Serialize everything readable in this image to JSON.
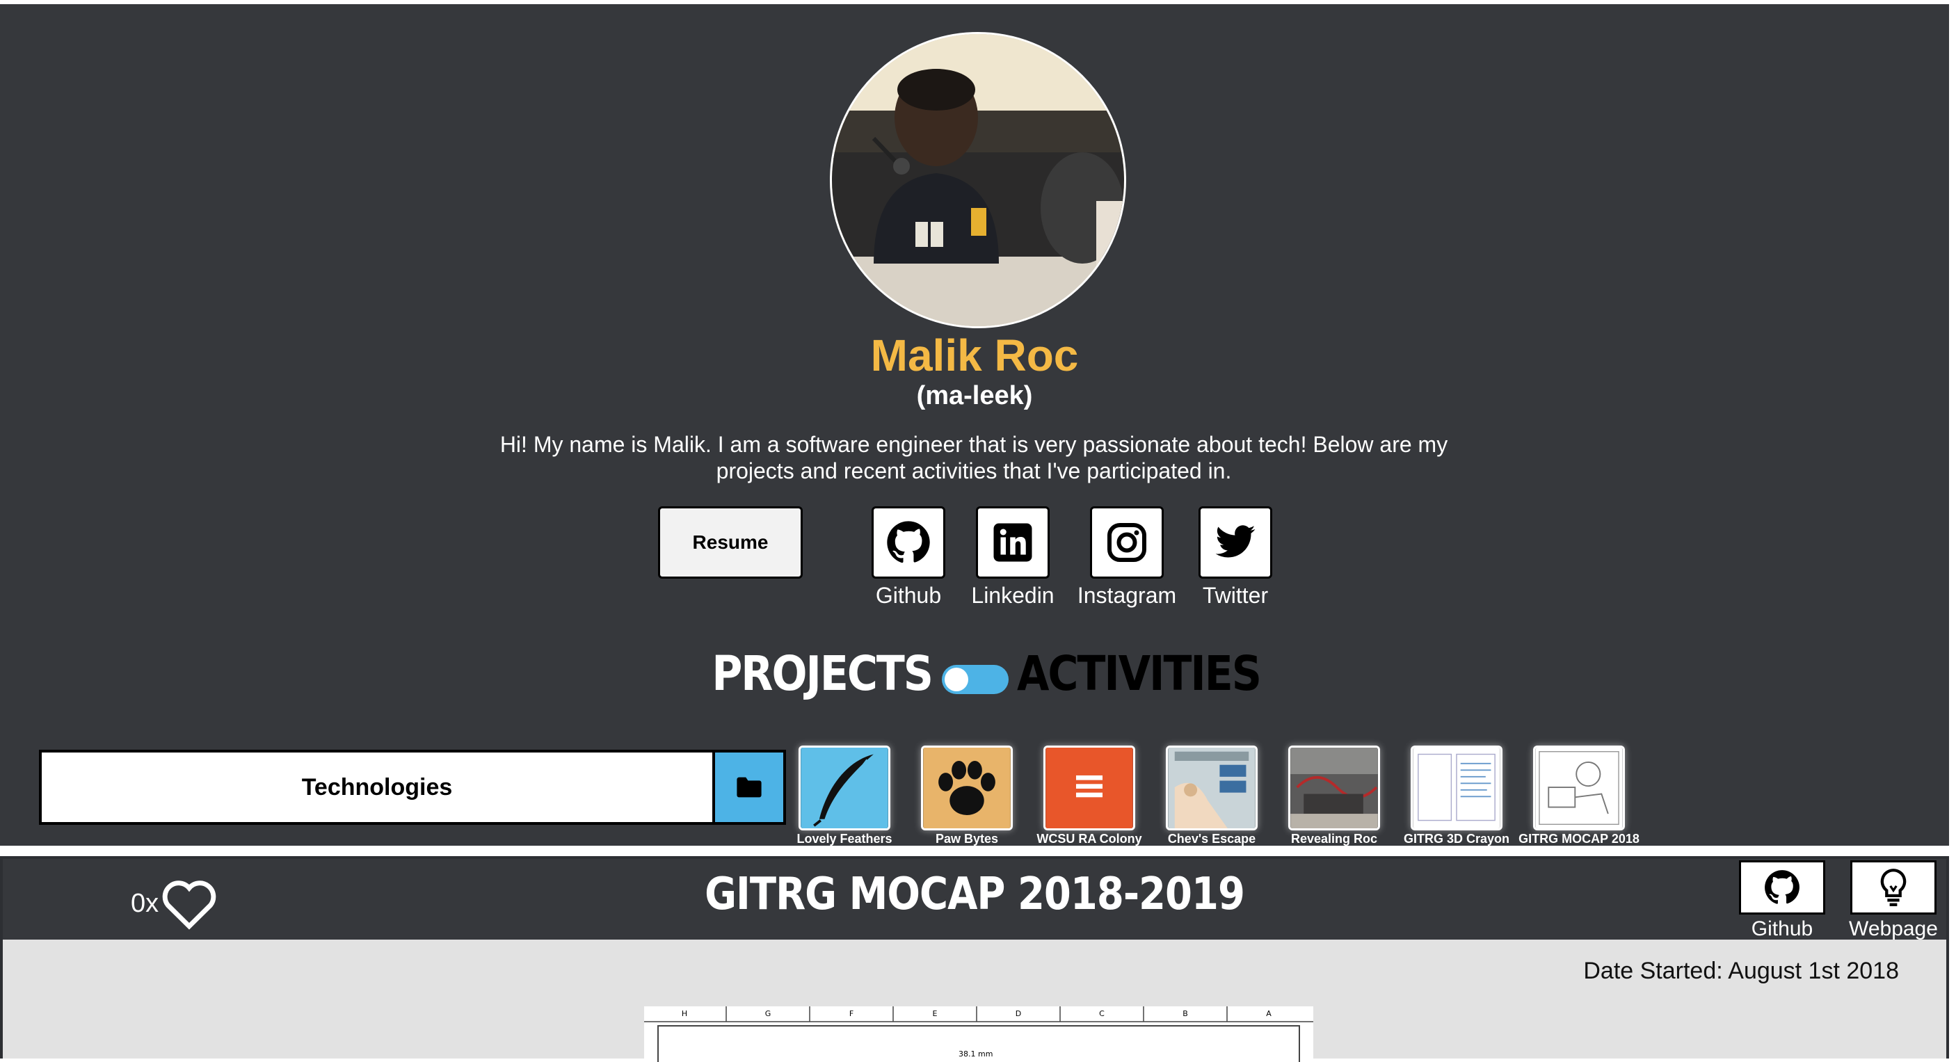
{
  "profile": {
    "name": "Malik Roc",
    "pronunciation": "(ma-leek)",
    "bio": "Hi! My name is Malik. I am a software engineer that is very passionate about tech! Below are my projects and recent activities that I've participated in."
  },
  "links": {
    "resume_label": "Resume",
    "social": [
      {
        "label": "Github",
        "icon": "github-icon"
      },
      {
        "label": "Linkedin",
        "icon": "linkedin-icon"
      },
      {
        "label": "Instagram",
        "icon": "instagram-icon"
      },
      {
        "label": "Twitter",
        "icon": "twitter-icon"
      }
    ]
  },
  "toggle": {
    "left_label": "PROJECTS",
    "right_label": "ACTIVITIES",
    "state": "projects"
  },
  "filter": {
    "label": "Technologies",
    "icon": "folder-icon"
  },
  "projects": [
    {
      "caption": "Lovely Feathers"
    },
    {
      "caption": "Paw Bytes"
    },
    {
      "caption": "WCSU RA Colony"
    },
    {
      "caption": "Chev's Escape"
    },
    {
      "caption": "Revealing Roc"
    },
    {
      "caption": "GITRG 3D Crayon"
    },
    {
      "caption": "GITRG MOCAP 2018"
    }
  ],
  "detail": {
    "likes": "0x",
    "title": "GITRG MOCAP 2018-2019",
    "github_label": "Github",
    "webpage_label": "Webpage",
    "date_started": "Date Started: August 1st 2018",
    "drawing_label": "38.1 mm",
    "drawing_columns": [
      "H",
      "G",
      "F",
      "E",
      "D",
      "C",
      "B",
      "A"
    ]
  },
  "colors": {
    "background": "#36383c",
    "accent_name": "#f4b945",
    "toggle": "#4db3e6"
  }
}
